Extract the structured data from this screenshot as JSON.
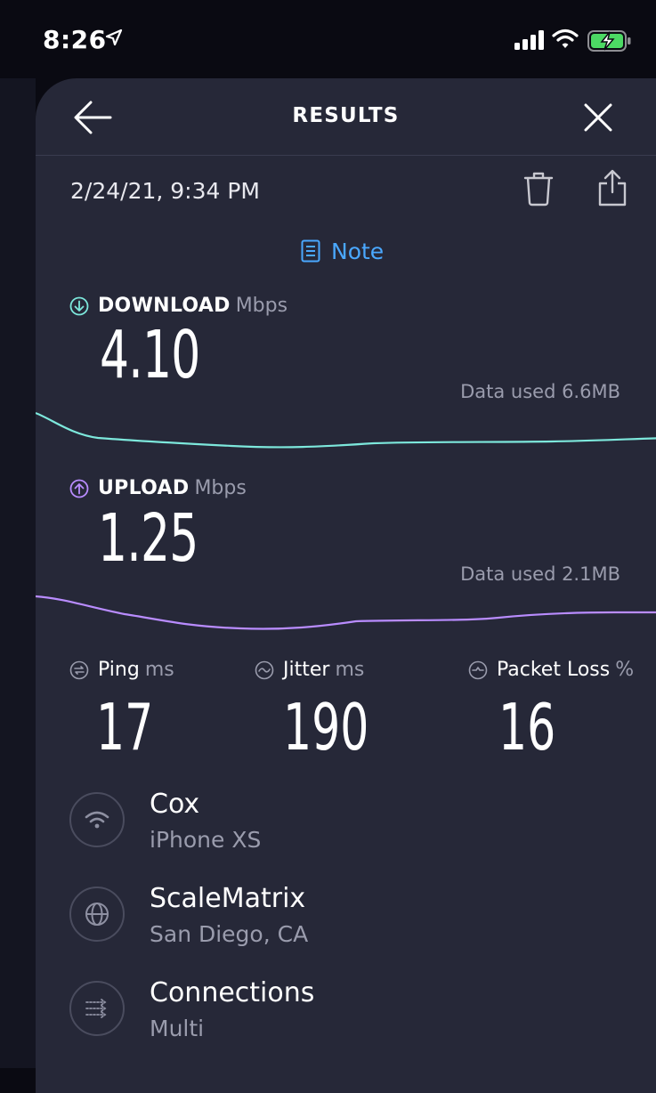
{
  "status_bar": {
    "time": "8:26"
  },
  "header": {
    "title": "RESULTS"
  },
  "result": {
    "datetime": "2/24/21, 9:34 PM",
    "note_label": "Note"
  },
  "download": {
    "label": "DOWNLOAD",
    "unit": "Mbps",
    "value": "4.10",
    "data_used": "Data used 6.6MB",
    "color": "#7de8dc"
  },
  "upload": {
    "label": "UPLOAD",
    "unit": "Mbps",
    "value": "1.25",
    "data_used": "Data used 2.1MB",
    "color": "#b98cff"
  },
  "stats": {
    "ping": {
      "label": "Ping",
      "unit": "ms",
      "value": "17"
    },
    "jitter": {
      "label": "Jitter",
      "unit": "ms",
      "value": "190"
    },
    "packet_loss": {
      "label": "Packet Loss",
      "unit": "%",
      "value": "16"
    }
  },
  "info": {
    "provider": {
      "title": "Cox",
      "subtitle": "iPhone XS",
      "icon": "wifi-icon"
    },
    "server": {
      "title": "ScaleMatrix",
      "subtitle": "San Diego, CA",
      "icon": "globe-icon"
    },
    "connections": {
      "title": "Connections",
      "subtitle": "Multi",
      "icon": "connections-icon"
    }
  },
  "colors": {
    "background": "#262838",
    "accent_blue": "#4aa8ff",
    "muted_text": "#9a9cad"
  }
}
